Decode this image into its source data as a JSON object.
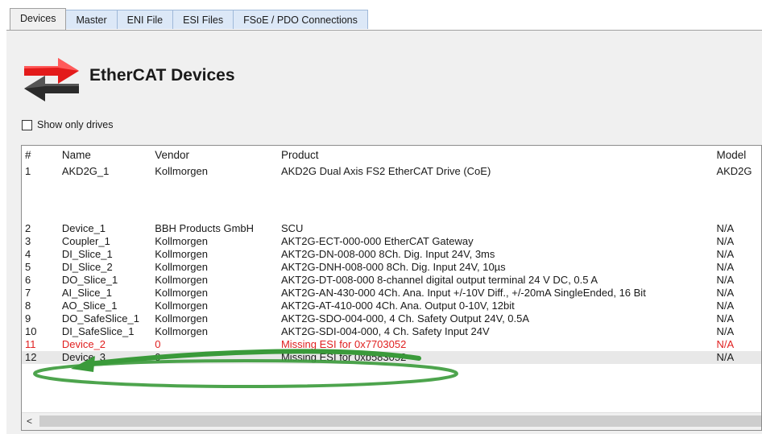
{
  "tabs": [
    {
      "label": "Devices",
      "active": true
    },
    {
      "label": "Master",
      "active": false
    },
    {
      "label": "ENI File",
      "active": false
    },
    {
      "label": "ESI Files",
      "active": false
    },
    {
      "label": "FSoE / PDO Connections",
      "active": false
    }
  ],
  "header": {
    "title": "EtherCAT Devices",
    "logo_icon": "ethercat-arrows-icon"
  },
  "filter": {
    "label": "Show only drives",
    "checked": false
  },
  "table": {
    "columns": [
      "#",
      "Name",
      "Vendor",
      "Product",
      "Model"
    ],
    "rows": [
      {
        "num": "1",
        "name": "AKD2G_1",
        "vendor": "Kollmorgen",
        "product": "AKD2G Dual Axis FS2 EtherCAT Drive (CoE)",
        "model": "AKD2G"
      },
      {
        "num": "2",
        "name": "Device_1",
        "vendor": "BBH Products GmbH",
        "product": "SCU",
        "model": "N/A"
      },
      {
        "num": "3",
        "name": "Coupler_1",
        "vendor": "Kollmorgen",
        "product": "AKT2G-ECT-000-000 EtherCAT Gateway",
        "model": "N/A"
      },
      {
        "num": "4",
        "name": "DI_Slice_1",
        "vendor": "Kollmorgen",
        "product": "AKT2G-DN-008-000 8Ch. Dig. Input 24V, 3ms",
        "model": "N/A"
      },
      {
        "num": "5",
        "name": "DI_Slice_2",
        "vendor": "Kollmorgen",
        "product": "AKT2G-DNH-008-000 8Ch. Dig. Input 24V, 10µs",
        "model": "N/A"
      },
      {
        "num": "6",
        "name": "DO_Slice_1",
        "vendor": "Kollmorgen",
        "product": "AKT2G-DT-008-000 8-channel digital output terminal 24 V DC, 0.5 A",
        "model": "N/A"
      },
      {
        "num": "7",
        "name": "AI_Slice_1",
        "vendor": "Kollmorgen",
        "product": "AKT2G-AN-430-000 4Ch. Ana. Input +/-10V Diff., +/-20mA SingleEnded, 16 Bit",
        "model": "N/A"
      },
      {
        "num": "8",
        "name": "AO_Slice_1",
        "vendor": "Kollmorgen",
        "product": "AKT2G-AT-410-000 4Ch. Ana. Output 0-10V, 12bit",
        "model": "N/A"
      },
      {
        "num": "9",
        "name": "DO_SafeSlice_1",
        "vendor": "Kollmorgen",
        "product": "AKT2G-SDO-004-000, 4 Ch. Safety Output 24V, 0.5A",
        "model": "N/A"
      },
      {
        "num": "10",
        "name": "DI_SafeSlice_1",
        "vendor": "Kollmorgen",
        "product": "AKT2G-SDI-004-000, 4 Ch. Safety Input 24V",
        "model": "N/A"
      },
      {
        "num": "11",
        "name": "Device_2",
        "vendor": "0",
        "product": "Missing ESI for 0x7703052",
        "model": "N/A",
        "error": true
      },
      {
        "num": "12",
        "name": "Device_3",
        "vendor": "0",
        "product": "Missing ESI for 0xb583052",
        "model": "N/A",
        "selected": true
      }
    ]
  },
  "scrollbar": {
    "left_arrow": "<"
  },
  "colors": {
    "error": "#e02020",
    "annotation": "#3a9a3a",
    "tab_bg": "#dce8f7",
    "panel_bg": "#f0f0f0"
  }
}
